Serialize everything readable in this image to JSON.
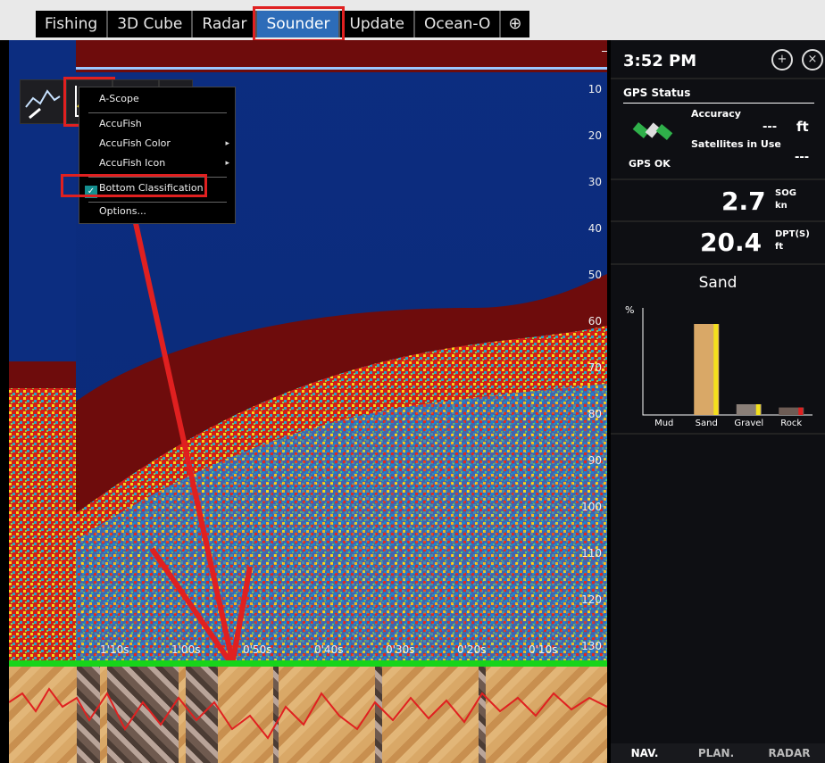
{
  "tabs": [
    {
      "label": "Fishing"
    },
    {
      "label": "3D Cube"
    },
    {
      "label": "Radar"
    },
    {
      "label": "Sounder",
      "active": true
    },
    {
      "label": "Update"
    },
    {
      "label": "Ocean-O"
    },
    {
      "label": "⊕"
    }
  ],
  "depth_axis": {
    "labels": [
      "10",
      "20",
      "30",
      "40",
      "50",
      "60",
      "70",
      "80",
      "90",
      "100",
      "110",
      "120",
      "130"
    ]
  },
  "time_axis": {
    "labels": [
      "1'10s",
      "1'00s",
      "0'50s",
      "0'40s",
      "0'30s",
      "0'20s",
      "0'10s"
    ]
  },
  "menu": {
    "items": [
      {
        "label": "A-Scope"
      },
      {
        "label": "AccuFish"
      },
      {
        "label": "AccuFish Color",
        "submenu": "▸"
      },
      {
        "label": "AccuFish Icon",
        "submenu": "▸"
      },
      {
        "label": "Bottom Classification",
        "checked": true
      },
      {
        "label": "Options..."
      }
    ]
  },
  "panel": {
    "time": "3:52 PM",
    "gps": {
      "title": "GPS Status",
      "accuracy_label": "Accuracy",
      "accuracy_value": "---",
      "accuracy_unit": "ft",
      "sat_label": "Satellites in Use",
      "sat_value": "---",
      "status": "GPS OK"
    },
    "sog": {
      "value": "2.7",
      "label": "SOG",
      "unit": "kn"
    },
    "depth": {
      "value": "20.4",
      "label": "DPT(S)",
      "unit": "ft"
    },
    "bottom": {
      "title": "Sand",
      "ylabel": "%"
    },
    "tabs": [
      "NAV.",
      "PLAN.",
      "RADAR"
    ]
  },
  "chart_data": {
    "type": "bar",
    "title": "Sand",
    "ylabel": "%",
    "categories": [
      "Mud",
      "Sand",
      "Gravel",
      "Rock"
    ],
    "values": [
      0,
      85,
      10,
      7
    ],
    "ylim": [
      0,
      100
    ]
  },
  "colors": {
    "accent": "#2d6cb8",
    "highlight": "#e02020",
    "bottom_line": "#17d41a",
    "water": "#0c2d80"
  }
}
